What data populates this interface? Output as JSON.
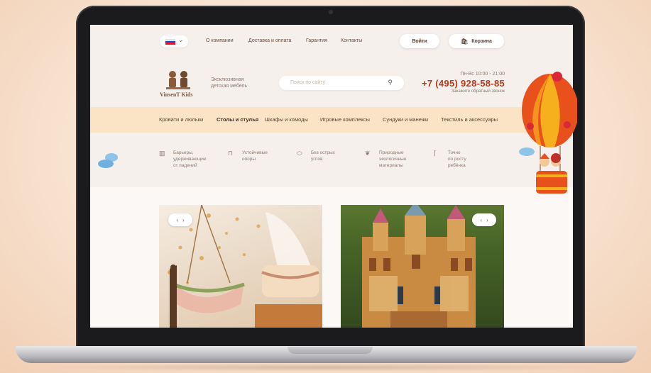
{
  "topbar": {
    "flag_colors": [
      "#ffffff",
      "#1a4fc4",
      "#d3202a"
    ],
    "links": [
      "О компании",
      "Доставка и оплата",
      "Гарантия",
      "Контакты"
    ],
    "login_label": "Войти",
    "cart_label": "Корзина"
  },
  "header": {
    "brand": "VinsenT Kids",
    "tagline_line1": "Эксклюзивная",
    "tagline_line2": "детская мебель",
    "search_placeholder": "Поиск по сайту",
    "hours": "Пн-Вс 10:00 - 21:00",
    "phone": "+7 (495) 928-58-85",
    "callback": "Закажите обратный звонок"
  },
  "categories": [
    {
      "label": "Кровати и люльки",
      "active": false
    },
    {
      "label": "Столы и стулья",
      "active": true
    },
    {
      "label": "Шкафы и комоды",
      "active": false
    },
    {
      "label": "Игровые комплексы",
      "active": false
    },
    {
      "label": "Сундуки и манежи",
      "active": false
    },
    {
      "label": "Текстиль и аксессуары",
      "active": false
    }
  ],
  "features": [
    {
      "icon": "barrier-icon",
      "line1": "Барьеры,",
      "line2": "удерживающие",
      "line3": "от падений"
    },
    {
      "icon": "support-icon",
      "line1": "Устойчивые",
      "line2": "опоры",
      "line3": ""
    },
    {
      "icon": "rounded-corners-icon",
      "line1": "Без острых",
      "line2": "углов",
      "line3": ""
    },
    {
      "icon": "leaf-icon",
      "line1": "Природные",
      "line2": "экологичные",
      "line3": "материалы"
    },
    {
      "icon": "ruler-icon",
      "line1": "Точно",
      "line2": "по росту",
      "line3": "ребёнка"
    }
  ],
  "colors": {
    "accent": "#b43a1c",
    "category_bar": "#fbe3c6",
    "brand_brown": "#7a5a43"
  }
}
